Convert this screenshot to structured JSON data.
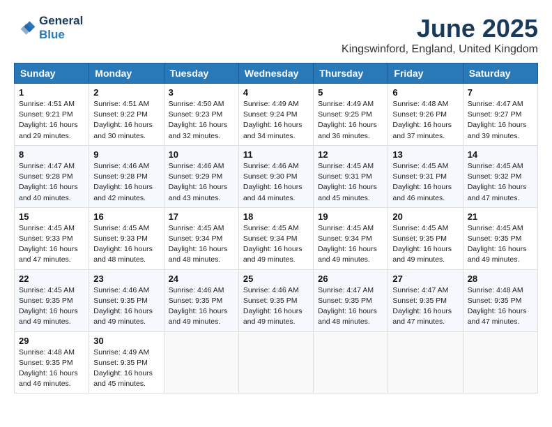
{
  "header": {
    "logo_line1": "General",
    "logo_line2": "Blue",
    "title": "June 2025",
    "subtitle": "Kingswinford, England, United Kingdom"
  },
  "weekdays": [
    "Sunday",
    "Monday",
    "Tuesday",
    "Wednesday",
    "Thursday",
    "Friday",
    "Saturday"
  ],
  "weeks": [
    [
      {
        "day": "1",
        "sunrise": "4:51 AM",
        "sunset": "9:21 PM",
        "daylight": "16 hours and 29 minutes."
      },
      {
        "day": "2",
        "sunrise": "4:51 AM",
        "sunset": "9:22 PM",
        "daylight": "16 hours and 30 minutes."
      },
      {
        "day": "3",
        "sunrise": "4:50 AM",
        "sunset": "9:23 PM",
        "daylight": "16 hours and 32 minutes."
      },
      {
        "day": "4",
        "sunrise": "4:49 AM",
        "sunset": "9:24 PM",
        "daylight": "16 hours and 34 minutes."
      },
      {
        "day": "5",
        "sunrise": "4:49 AM",
        "sunset": "9:25 PM",
        "daylight": "16 hours and 36 minutes."
      },
      {
        "day": "6",
        "sunrise": "4:48 AM",
        "sunset": "9:26 PM",
        "daylight": "16 hours and 37 minutes."
      },
      {
        "day": "7",
        "sunrise": "4:47 AM",
        "sunset": "9:27 PM",
        "daylight": "16 hours and 39 minutes."
      }
    ],
    [
      {
        "day": "8",
        "sunrise": "4:47 AM",
        "sunset": "9:28 PM",
        "daylight": "16 hours and 40 minutes."
      },
      {
        "day": "9",
        "sunrise": "4:46 AM",
        "sunset": "9:28 PM",
        "daylight": "16 hours and 42 minutes."
      },
      {
        "day": "10",
        "sunrise": "4:46 AM",
        "sunset": "9:29 PM",
        "daylight": "16 hours and 43 minutes."
      },
      {
        "day": "11",
        "sunrise": "4:46 AM",
        "sunset": "9:30 PM",
        "daylight": "16 hours and 44 minutes."
      },
      {
        "day": "12",
        "sunrise": "4:45 AM",
        "sunset": "9:31 PM",
        "daylight": "16 hours and 45 minutes."
      },
      {
        "day": "13",
        "sunrise": "4:45 AM",
        "sunset": "9:31 PM",
        "daylight": "16 hours and 46 minutes."
      },
      {
        "day": "14",
        "sunrise": "4:45 AM",
        "sunset": "9:32 PM",
        "daylight": "16 hours and 47 minutes."
      }
    ],
    [
      {
        "day": "15",
        "sunrise": "4:45 AM",
        "sunset": "9:33 PM",
        "daylight": "16 hours and 47 minutes."
      },
      {
        "day": "16",
        "sunrise": "4:45 AM",
        "sunset": "9:33 PM",
        "daylight": "16 hours and 48 minutes."
      },
      {
        "day": "17",
        "sunrise": "4:45 AM",
        "sunset": "9:34 PM",
        "daylight": "16 hours and 48 minutes."
      },
      {
        "day": "18",
        "sunrise": "4:45 AM",
        "sunset": "9:34 PM",
        "daylight": "16 hours and 49 minutes."
      },
      {
        "day": "19",
        "sunrise": "4:45 AM",
        "sunset": "9:34 PM",
        "daylight": "16 hours and 49 minutes."
      },
      {
        "day": "20",
        "sunrise": "4:45 AM",
        "sunset": "9:35 PM",
        "daylight": "16 hours and 49 minutes."
      },
      {
        "day": "21",
        "sunrise": "4:45 AM",
        "sunset": "9:35 PM",
        "daylight": "16 hours and 49 minutes."
      }
    ],
    [
      {
        "day": "22",
        "sunrise": "4:45 AM",
        "sunset": "9:35 PM",
        "daylight": "16 hours and 49 minutes."
      },
      {
        "day": "23",
        "sunrise": "4:46 AM",
        "sunset": "9:35 PM",
        "daylight": "16 hours and 49 minutes."
      },
      {
        "day": "24",
        "sunrise": "4:46 AM",
        "sunset": "9:35 PM",
        "daylight": "16 hours and 49 minutes."
      },
      {
        "day": "25",
        "sunrise": "4:46 AM",
        "sunset": "9:35 PM",
        "daylight": "16 hours and 49 minutes."
      },
      {
        "day": "26",
        "sunrise": "4:47 AM",
        "sunset": "9:35 PM",
        "daylight": "16 hours and 48 minutes."
      },
      {
        "day": "27",
        "sunrise": "4:47 AM",
        "sunset": "9:35 PM",
        "daylight": "16 hours and 47 minutes."
      },
      {
        "day": "28",
        "sunrise": "4:48 AM",
        "sunset": "9:35 PM",
        "daylight": "16 hours and 47 minutes."
      }
    ],
    [
      {
        "day": "29",
        "sunrise": "4:48 AM",
        "sunset": "9:35 PM",
        "daylight": "16 hours and 46 minutes."
      },
      {
        "day": "30",
        "sunrise": "4:49 AM",
        "sunset": "9:35 PM",
        "daylight": "16 hours and 45 minutes."
      },
      null,
      null,
      null,
      null,
      null
    ]
  ]
}
